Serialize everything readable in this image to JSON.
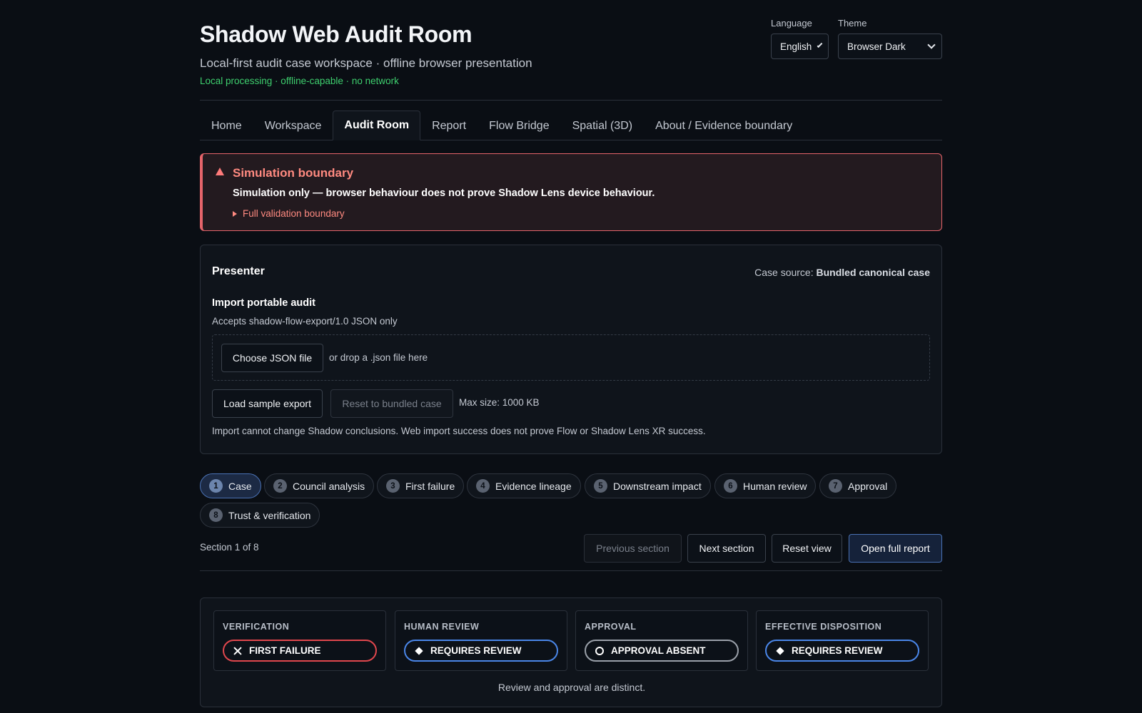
{
  "header": {
    "title": "Shadow Web Audit Room",
    "subtitle": "Local-first audit case workspace · offline browser presentation",
    "status": "Local processing · offline-capable · no network",
    "language_label": "Language",
    "language_value": "English",
    "theme_label": "Theme",
    "theme_value": "Browser Dark"
  },
  "tabs": [
    {
      "label": "Home"
    },
    {
      "label": "Workspace"
    },
    {
      "label": "Audit Room",
      "active": true
    },
    {
      "label": "Report"
    },
    {
      "label": "Flow Bridge"
    },
    {
      "label": "Spatial (3D)"
    },
    {
      "label": "About / Evidence boundary"
    }
  ],
  "boundary": {
    "title": "Simulation boundary",
    "text": "Simulation only — browser behaviour does not prove Shadow Lens device behaviour.",
    "link": "Full validation boundary"
  },
  "presenter": {
    "title": "Presenter",
    "case_source_label": "Case source:",
    "case_source_value": "Bundled canonical case",
    "import_title": "Import portable audit",
    "accepts": "Accepts shadow-flow-export/1.0 JSON only",
    "choose_button": "Choose JSON file",
    "drop_hint": "or drop a .json file here",
    "load_sample_button": "Load sample export",
    "reset_button": "Reset to bundled case",
    "max_size": "Max size: 1000 KB",
    "note": "Import cannot change Shadow conclusions. Web import success does not prove Flow or Shadow Lens XR success."
  },
  "sections": [
    {
      "num": "1",
      "label": "Case",
      "active": true
    },
    {
      "num": "2",
      "label": "Council analysis"
    },
    {
      "num": "3",
      "label": "First failure"
    },
    {
      "num": "4",
      "label": "Evidence lineage"
    },
    {
      "num": "5",
      "label": "Downstream impact"
    },
    {
      "num": "6",
      "label": "Human review"
    },
    {
      "num": "7",
      "label": "Approval"
    },
    {
      "num": "8",
      "label": "Trust & verification"
    }
  ],
  "nav": {
    "section_count": "Section 1 of 8",
    "previous": "Previous section",
    "next": "Next section",
    "reset_view": "Reset view",
    "open_report": "Open full report"
  },
  "status_cards": [
    {
      "label": "VERIFICATION",
      "value": "FIRST FAILURE",
      "icon": "x-icon",
      "color": "#e0474d"
    },
    {
      "label": "HUMAN REVIEW",
      "value": "REQUIRES REVIEW",
      "icon": "diamond-icon",
      "color": "#4a86e8"
    },
    {
      "label": "APPROVAL",
      "value": "APPROVAL ABSENT",
      "icon": "circle-icon",
      "color": "#9aa0a9"
    },
    {
      "label": "EFFECTIVE DISPOSITION",
      "value": "REQUIRES REVIEW",
      "icon": "diamond-icon",
      "color": "#4a86e8"
    }
  ],
  "status_note": "Review and approval are distinct.",
  "colors": {
    "background": "#0a0e14",
    "accent": "#4a72b5",
    "status_ok": "#3ecf6e",
    "warning": "#e5646a"
  }
}
